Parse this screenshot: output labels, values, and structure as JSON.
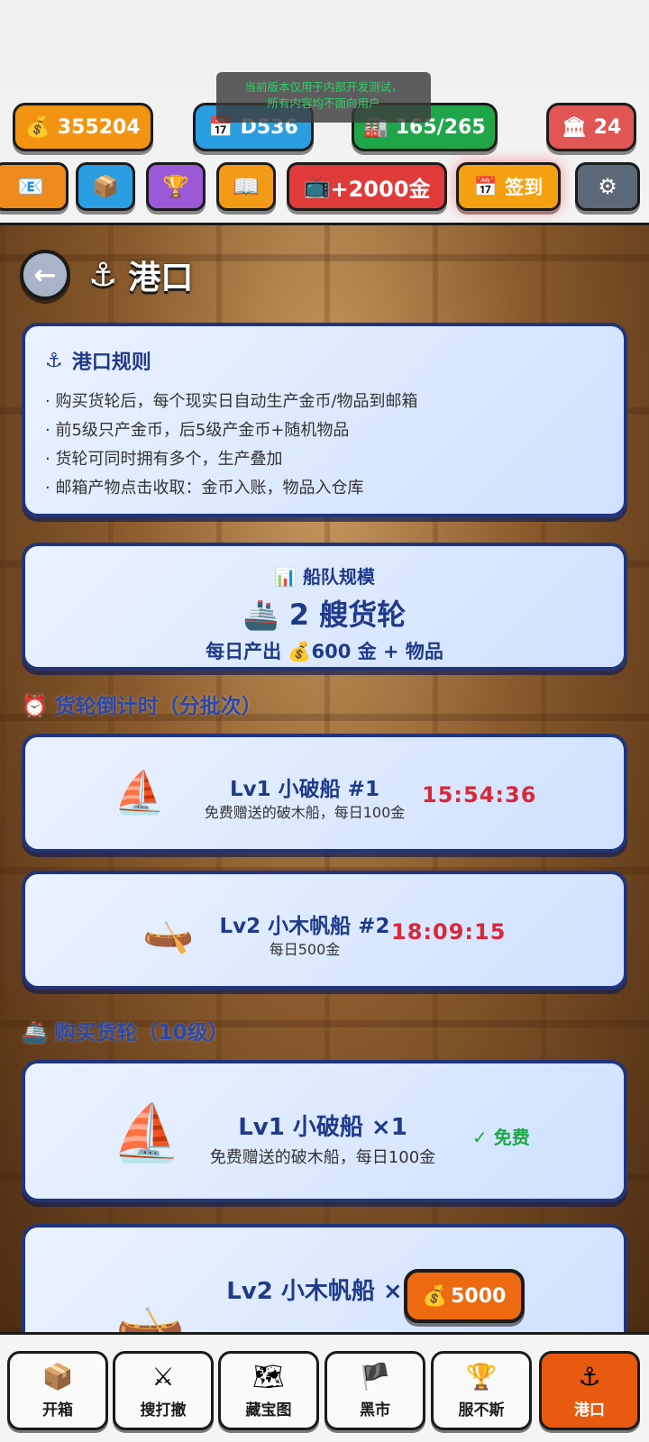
{
  "notice": {
    "line1": "当前版本仅用于内部开发测试，",
    "line2": "所有内容均不面向用户"
  },
  "stats": {
    "gold": "355204",
    "day": "D536",
    "capacity": "165/265",
    "bank": "24"
  },
  "toolbar": {
    "ad_reward": "+2000金",
    "sign_in": "签到"
  },
  "page": {
    "title": "港口"
  },
  "rules": {
    "title": "港口规则",
    "items": [
      "· 购买货轮后，每个现实日自动生产金币/物品到邮箱",
      "· 前5级只产金币，后5级产金币+随机物品",
      "· 货轮可同时拥有多个，生产叠加",
      "· 邮箱产物点击收取：金币入账，物品入仓库"
    ]
  },
  "fleet": {
    "label": "船队规模",
    "count": "2 艘货轮",
    "daily": "每日产出 💰600 金 + 物品"
  },
  "countdown": {
    "title": "货轮倒计时（分批次）",
    "ships": [
      {
        "name": "Lv1 小破船 #1",
        "desc": "免费赠送的破木船，每日100金",
        "timer": "15:54:36",
        "icon": "sailboat-icon"
      },
      {
        "name": "Lv2 小木帆船 #2",
        "desc": "每日500金",
        "timer": "18:09:15",
        "icon": "canoe-icon"
      }
    ]
  },
  "shop": {
    "title": "购买货轮（10级）",
    "items": [
      {
        "name": "Lv1 小破船 ×1",
        "desc": "免费赠送的破木船，每日100金",
        "price": "免费",
        "icon": "sailboat-icon"
      },
      {
        "name": "Lv2 小木帆船 ×1",
        "price": "5000",
        "icon": "canoe-icon"
      }
    ]
  },
  "nav": [
    {
      "label": "开箱",
      "icon": "package-icon"
    },
    {
      "label": "搜打撤",
      "icon": "crossed-swords-icon"
    },
    {
      "label": "藏宝图",
      "icon": "map-icon"
    },
    {
      "label": "黑市",
      "icon": "pirate-flag-icon"
    },
    {
      "label": "服不斯",
      "icon": "trophy-icon"
    },
    {
      "label": "港口",
      "icon": "anchor-icon"
    }
  ],
  "colors": {
    "accent_orange": "#ee6a10",
    "card_border": "#22357a",
    "title_blue": "#1f3a8a",
    "timer_red": "#d8283a",
    "free_green": "#1ea84a"
  }
}
